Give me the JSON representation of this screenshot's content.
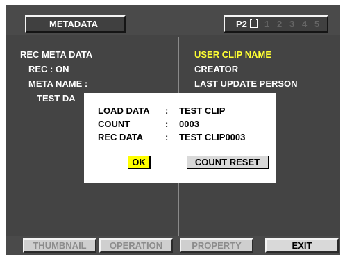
{
  "header": {
    "title": "METADATA",
    "card_label": "P2",
    "slots": [
      "1",
      "2",
      "3",
      "4",
      "5"
    ]
  },
  "left_panel": {
    "heading": "REC META DATA",
    "rec_status": "REC : ON",
    "meta_name_label": "META NAME :",
    "meta_name_value_partial": "TEST DA"
  },
  "right_panel": {
    "items": [
      "USER CLIP NAME",
      "CREATOR",
      "LAST UPDATE PERSON"
    ],
    "selected_color": "#ffff33"
  },
  "dialog": {
    "rows": [
      {
        "label": "LOAD DATA",
        "colon": ":",
        "value": "TEST CLIP"
      },
      {
        "label": "COUNT",
        "colon": ":",
        "value": "0003"
      },
      {
        "label": "REC DATA",
        "colon": ":",
        "value": "TEST CLIP0003"
      }
    ],
    "ok_label": "OK",
    "reset_label": "COUNT RESET"
  },
  "footer": {
    "thumbnail_label": "THUMBNAIL",
    "operation_label": "OPERATION",
    "property_label": "PROPERTY",
    "exit_label": "EXIT"
  }
}
